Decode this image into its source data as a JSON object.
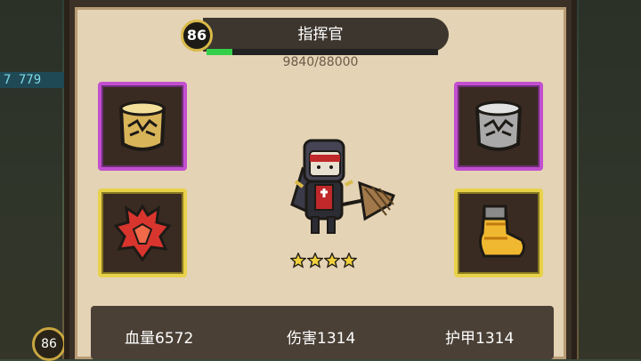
{
  "background": {
    "left_bar_text": "7 779",
    "left_badge_level": "86"
  },
  "hero": {
    "level": "86",
    "title": "指挥官",
    "exp_text": "9840/88000",
    "exp_fraction": 0.1118,
    "stars": 4
  },
  "slots": [
    {
      "name": "bracer-left",
      "rarity": "purple",
      "icon": "gold-bracer-icon"
    },
    {
      "name": "bracer-right",
      "rarity": "purple",
      "icon": "silver-bracer-icon"
    },
    {
      "name": "pauldron",
      "rarity": "gold",
      "icon": "red-pauldron-icon"
    },
    {
      "name": "boots",
      "rarity": "gold",
      "icon": "golden-boot-icon"
    }
  ],
  "stats": {
    "hp": "血量6572",
    "damage": "伤害1314",
    "armor": "护甲1314"
  },
  "colors": {
    "purple_rarity": "#c24fcf",
    "gold_rarity": "#e8d24a",
    "exp_bar": "#34d04a"
  }
}
